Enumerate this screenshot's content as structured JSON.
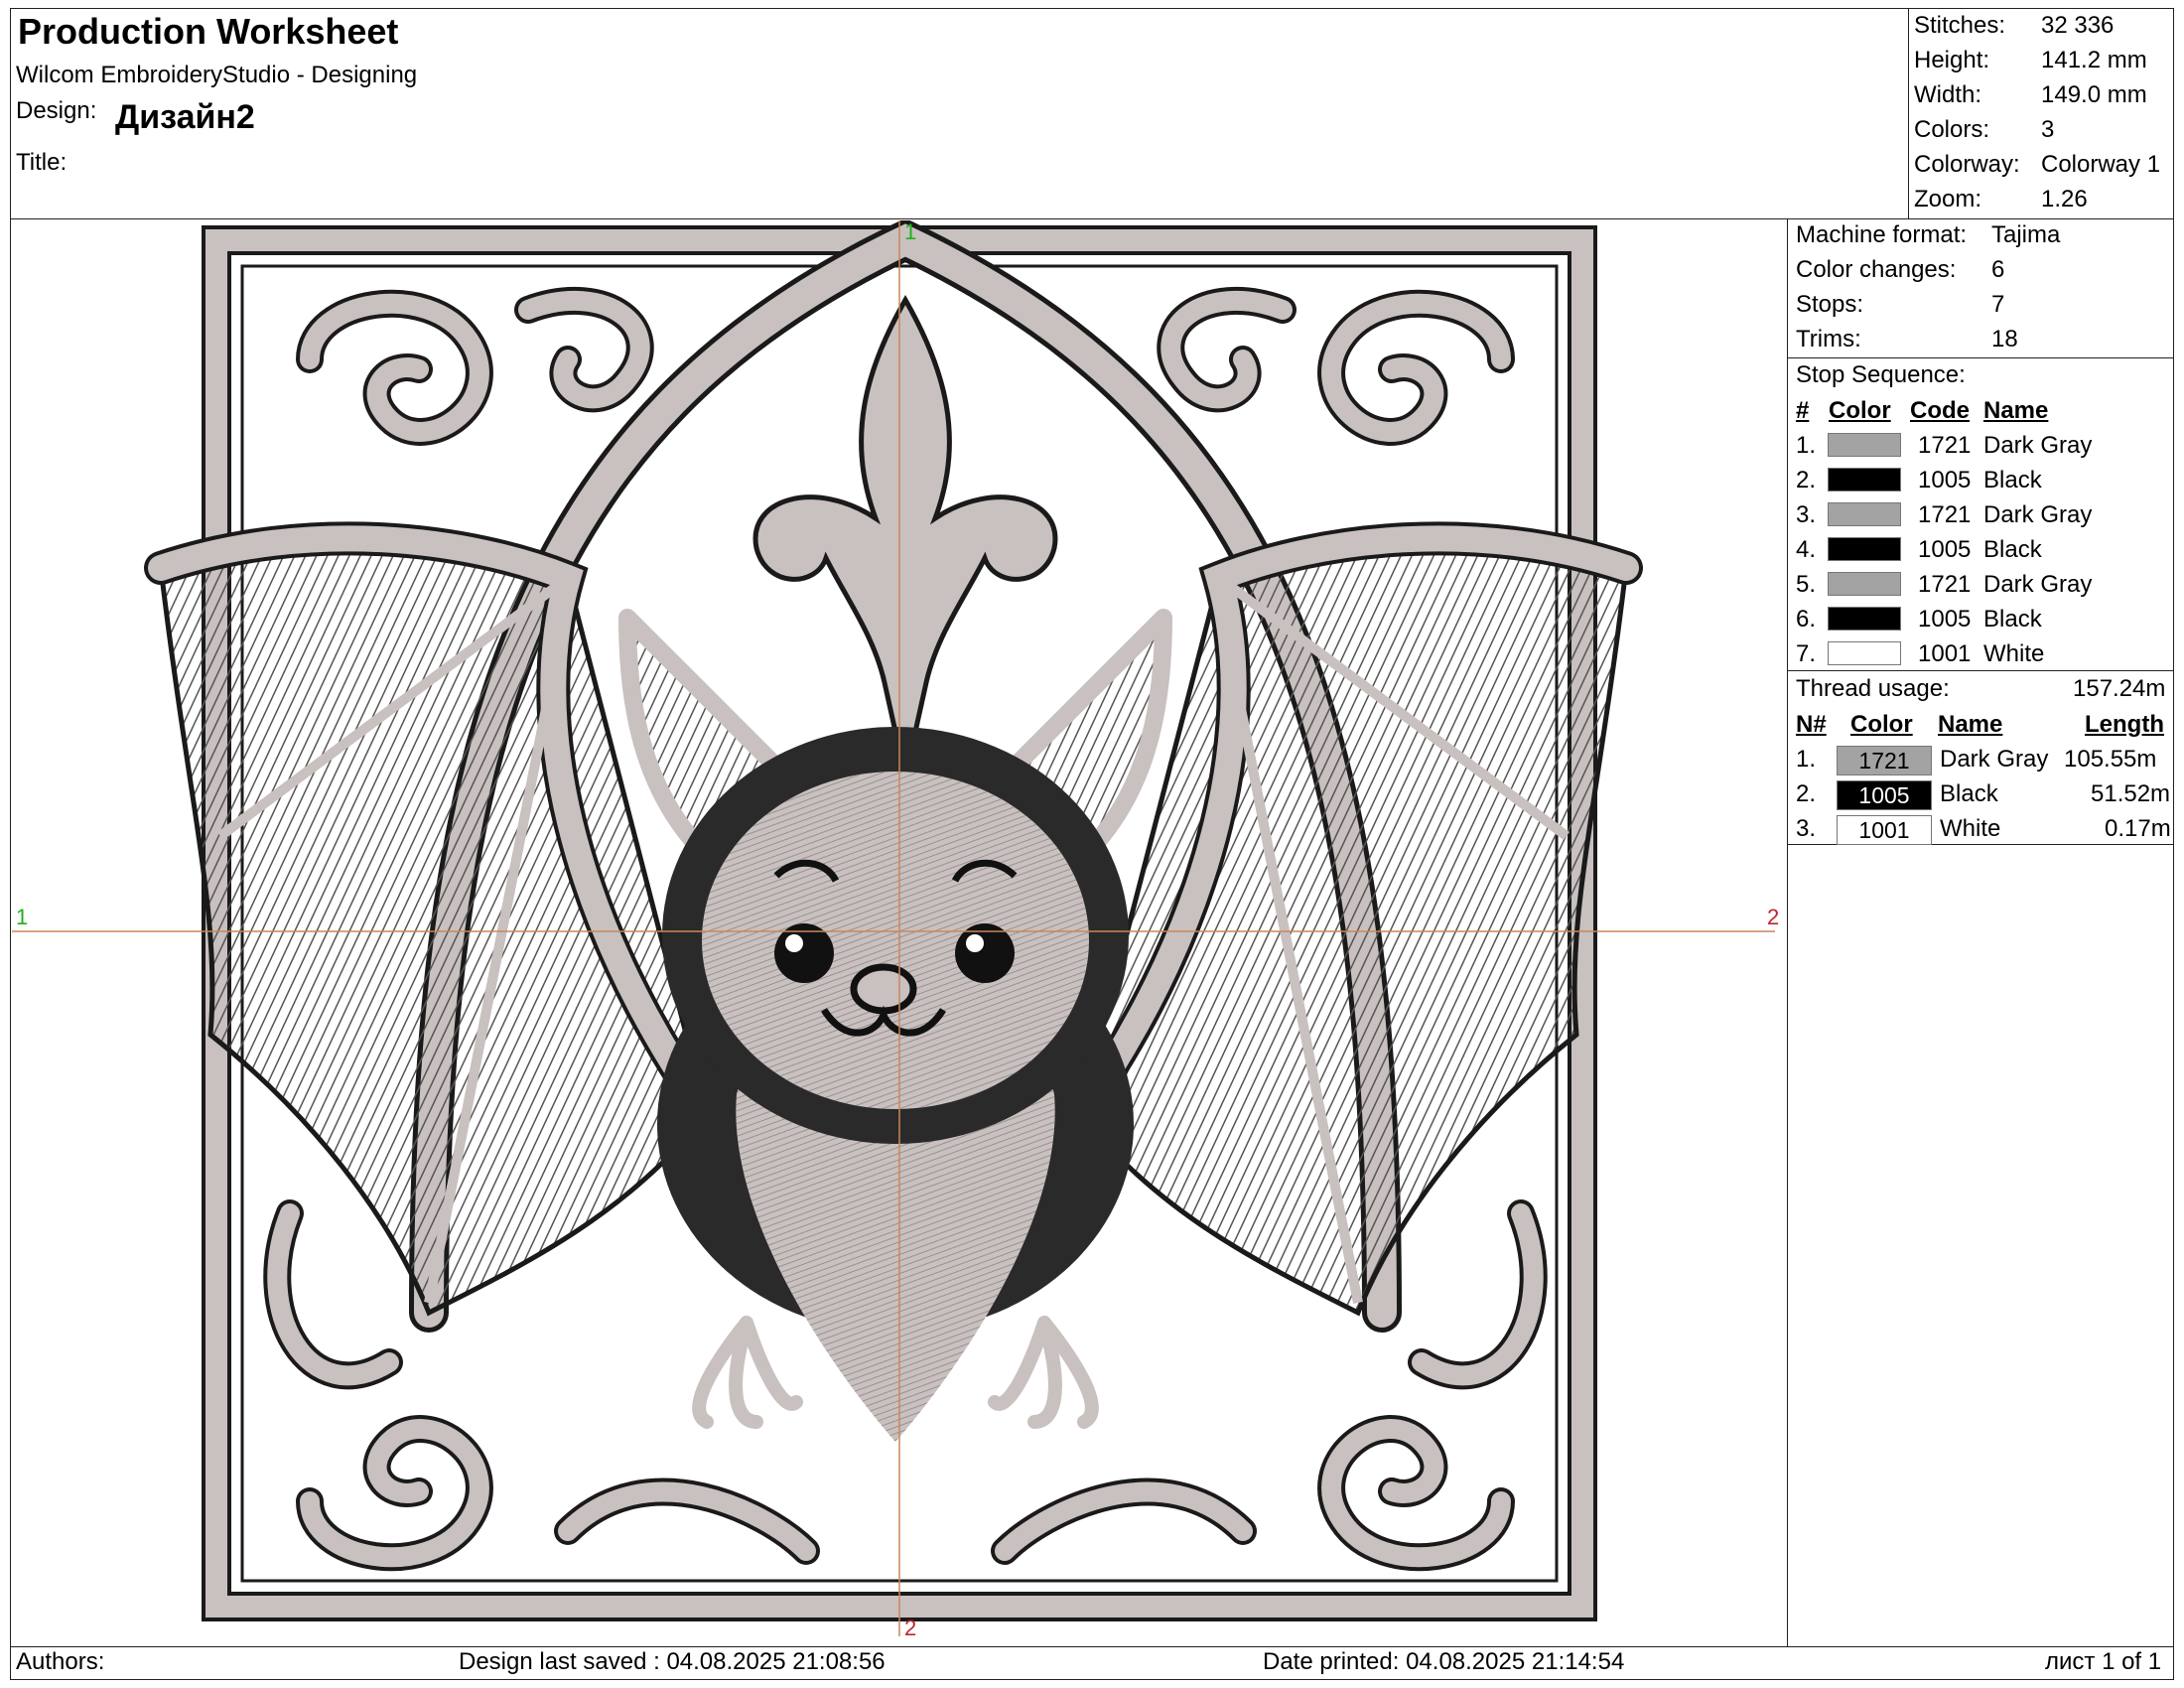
{
  "header": {
    "title": "Production Worksheet",
    "app": "Wilcom EmbroideryStudio - Designing",
    "design_label": "Design:",
    "design_name": "Дизайн2",
    "title_label": "Title:"
  },
  "summary": [
    {
      "label": "Stitches:",
      "value": "32 336"
    },
    {
      "label": "Height:",
      "value": "141.2 mm"
    },
    {
      "label": "Width:",
      "value": "149.0 mm"
    },
    {
      "label": "Colors:",
      "value": "3"
    },
    {
      "label": "Colorway:",
      "value": "Colorway 1"
    },
    {
      "label": "Zoom:",
      "value": "1.26"
    }
  ],
  "machine": [
    {
      "label": "Machine format:",
      "value": "Tajima"
    },
    {
      "label": "Color changes:",
      "value": "6"
    },
    {
      "label": "Stops:",
      "value": "7"
    },
    {
      "label": "Trims:",
      "value": "18"
    }
  ],
  "stop_sequence": {
    "title": "Stop Sequence:",
    "headers": {
      "num": "#",
      "color": "Color",
      "code": "Code",
      "name": "Name"
    },
    "rows": [
      {
        "num": "1.",
        "code": "1721",
        "name": "Dark Gray",
        "hex": "#a3a3a3"
      },
      {
        "num": "2.",
        "code": "1005",
        "name": "Black",
        "hex": "#000000"
      },
      {
        "num": "3.",
        "code": "1721",
        "name": "Dark Gray",
        "hex": "#a3a3a3"
      },
      {
        "num": "4.",
        "code": "1005",
        "name": "Black",
        "hex": "#000000"
      },
      {
        "num": "5.",
        "code": "1721",
        "name": "Dark Gray",
        "hex": "#a3a3a3"
      },
      {
        "num": "6.",
        "code": "1005",
        "name": "Black",
        "hex": "#000000"
      },
      {
        "num": "7.",
        "code": "1001",
        "name": "White",
        "hex": "#ffffff"
      }
    ]
  },
  "thread_usage": {
    "title": "Thread usage:",
    "total": "157.24m",
    "headers": {
      "num": "N#",
      "color": "Color",
      "name": "Name",
      "length": "Length"
    },
    "rows": [
      {
        "num": "1.",
        "code": "1721",
        "name": "Dark Gray",
        "length": "105.55m",
        "hex": "#a3a3a3",
        "text": "#000000"
      },
      {
        "num": "2.",
        "code": "1005",
        "name": "Black",
        "length": "51.52m",
        "hex": "#000000",
        "text": "#ffffff"
      },
      {
        "num": "3.",
        "code": "1001",
        "name": "White",
        "length": "0.17m",
        "hex": "#ffffff",
        "text": "#000000"
      }
    ]
  },
  "crosshair": {
    "top": "1",
    "left": "1",
    "right": "2",
    "bottom": "2"
  },
  "colors": {
    "thread_gray": "#c9c0c0",
    "thread_dark": "#1a1a1a",
    "crosshair": "#c8875a"
  },
  "footer": {
    "authors": "Authors:",
    "saved": "Design last saved : 04.08.2025 21:08:56",
    "printed": "Date printed: 04.08.2025 21:14:54",
    "page": "лист 1 of 1"
  }
}
